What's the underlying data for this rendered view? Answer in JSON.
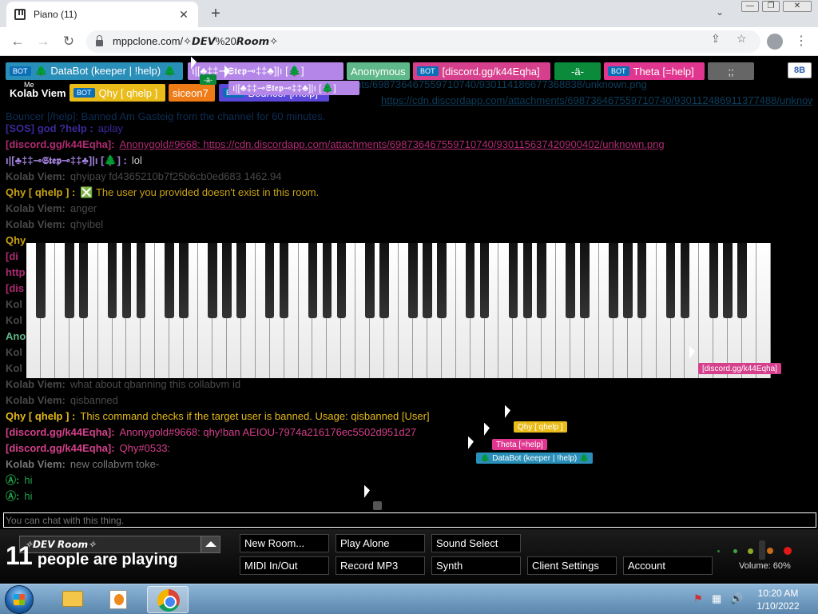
{
  "browser": {
    "tab_title": "Piano (11)",
    "tab_close": "✕",
    "new_tab": "+",
    "tab_search": "⌄",
    "win_min": "—",
    "win_restore": "❐",
    "win_close": "✕",
    "back": "←",
    "forward": "→",
    "reload": "↻",
    "url": "mppclone.com/✧𝘿𝙀𝙑%20𝙍𝙤𝙤𝙢✧",
    "share": "⇪",
    "bookmark": "☆",
    "menu": "⋮"
  },
  "names": [
    {
      "label": "🌲 DataBot (keeper | !help) 🌲",
      "bot": "BOT",
      "color": "#2a8fb8"
    },
    {
      "label": "ı|[♣‡‡⊸𝕾𝖙𝖊𝖕⊸‡‡♣]|ı [🌲]",
      "bot": "",
      "color": "#b486e8"
    },
    {
      "label": "Anonymous",
      "bot": "",
      "color": "#5fb889"
    },
    {
      "label": "[discord.gg/k44Eqha]",
      "bot": "BOT",
      "color": "#d63f8c"
    },
    {
      "label": "-ä-",
      "bot": "",
      "color": "#0a8a3a"
    },
    {
      "label": "Theta [=help]",
      "bot": "BOT",
      "color": "#e0368f"
    },
    {
      "label": ";;",
      "bot": "",
      "color": "#666666"
    },
    {
      "label": "Kolab Viem",
      "bot": "",
      "color": "#000000"
    },
    {
      "label": "Qhy [ qhelp ]",
      "bot": "BOT",
      "color": "#e9bc1a"
    },
    {
      "label": "siceon7",
      "bot": "",
      "color": "#ef7b16"
    },
    {
      "label": "Bouncer [/help]",
      "bot": "BOT",
      "color": "#5b48d8"
    }
  ],
  "badges": {
    "me": "Me",
    "ab": "8B"
  },
  "floating": {
    "a": "-ä-",
    "step": "ı|[♣‡‡⊸𝕾𝖙𝖊𝖕⊸‡‡♣]|ı [🌲]"
  },
  "chat": [
    {
      "name": "[SOS] god ?help :",
      "text": "aplay",
      "ncolor": "#3a2a9a",
      "tcolor": "#3a2a9a"
    },
    {
      "name": "[discord.gg/k44Eqha]:",
      "text": "Anonygold#9668: https://cdn.discordapp.com/attachments/698736467559710740/930115637420900402/unknown.png",
      "ncolor": "#b02a72",
      "tcolor": "#b02a72"
    },
    {
      "name": "ı|[♣‡‡⊸𝕾𝖙𝖊𝖕⊸‡‡♣]|ı [🌲] :",
      "text": "lol",
      "ncolor": "#a17fd9",
      "tcolor": "#cccccc"
    },
    {
      "name": "Kolab Viem:",
      "text": "qhyipay fd4365210b7f25b6cb0ed683 1462.94",
      "ncolor": "#4a4a4a",
      "tcolor": "#4a4a4a"
    },
    {
      "name": "Qhy [ qhelp ] :",
      "text": "❎ The user you provided doesn't exist in this room.",
      "ncolor": "#c9a313",
      "tcolor": "#c9a313"
    },
    {
      "name": "Kolab Viem:",
      "text": "anger",
      "ncolor": "#4a4a4a",
      "tcolor": "#4a4a4a"
    },
    {
      "name": "Kolab Viem:",
      "text": "qhyibel",
      "ncolor": "#4a4a4a",
      "tcolor": "#4a4a4a"
    },
    {
      "name": "Qhy",
      "text": "",
      "ncolor": "#c9a313",
      "tcolor": "#c9a313"
    },
    {
      "name": "[di",
      "text": "",
      "ncolor": "#b02a72",
      "tcolor": "#b02a72"
    },
    {
      "name": "http",
      "text": "",
      "ncolor": "#b02a72",
      "tcolor": "#b02a72"
    },
    {
      "name": "[dis",
      "text": "",
      "ncolor": "#b02a72",
      "tcolor": "#b02a72"
    },
    {
      "name": "Kol",
      "text": "",
      "ncolor": "#4a4a4a",
      "tcolor": "#4a4a4a"
    },
    {
      "name": "Kol",
      "text": "",
      "ncolor": "#4a4a4a",
      "tcolor": "#4a4a4a"
    },
    {
      "name": "Ano",
      "text": "",
      "ncolor": "#5fb889",
      "tcolor": "#5fb889"
    },
    {
      "name": "Kol",
      "text": "",
      "ncolor": "#4a4a4a",
      "tcolor": "#4a4a4a"
    },
    {
      "name": "Kol",
      "text": "",
      "ncolor": "#4a4a4a",
      "tcolor": "#4a4a4a"
    },
    {
      "name": "Kolab Viem:",
      "text": "what about qbanning this collabvm id",
      "ncolor": "#4a4a4a",
      "tcolor": "#4a4a4a"
    },
    {
      "name": "Kolab Viem:",
      "text": "qisbanned",
      "ncolor": "#4a4a4a",
      "tcolor": "#4a4a4a"
    },
    {
      "name": "Qhy [ qhelp ] :",
      "text": "This command checks if the target user is banned. Usage: qisbanned [User]",
      "ncolor": "#e3b91a",
      "tcolor": "#e3b91a"
    },
    {
      "name": "[discord.gg/k44Eqha]:",
      "text": "Anonygold#9668: qhy!ban AEIOU-7974a216176ec5502d951d27",
      "ncolor": "#d63f8c",
      "tcolor": "#d63f8c"
    },
    {
      "name": "[discord.gg/k44Eqha]:",
      "text": "Qhy#0533:",
      "ncolor": "#d63f8c",
      "tcolor": "#d63f8c"
    },
    {
      "name": "Kolab Viem:",
      "text": "new collabvm toke-",
      "ncolor": "#777777",
      "tcolor": "#777777"
    },
    {
      "name": "Ⓐ:",
      "text": "hi",
      "ncolor": "#1fa34a",
      "tcolor": "#1fa34a"
    },
    {
      "name": "Ⓐ:",
      "text": "hi",
      "ncolor": "#1fa34a",
      "tcolor": "#1fa34a"
    }
  ],
  "top_links": {
    "l1": "ments/698736467559710740/930114186677368838/unknown.png",
    "l2": "https://cdn.discordapp.com/attachments/698736467559710740/930112486911377488/unknown.png",
    "bouncer": "Bouncer [/help]:  Banned Am Gasteig from the channel for 60 minutes."
  },
  "cursor_tags": [
    {
      "label": "[discord.gg/k44Eqha]",
      "color": "#d63f8c"
    },
    {
      "label": "Qhy [ qhelp ]",
      "color": "#e9bc1a"
    },
    {
      "label": "Theta [=help]",
      "color": "#e0368f"
    },
    {
      "label": "🌲 DataBot (keeper | !help) 🌲",
      "color": "#2a8fb8"
    }
  ],
  "chat_input": {
    "placeholder": "You can chat with this thing."
  },
  "room": {
    "name": "✧𝘿𝙀𝙑 𝙍𝙤𝙤𝙢✧",
    "count": "11",
    "count_text": "people are playing"
  },
  "buttons": {
    "new_room": "New Room...",
    "play_alone": "Play Alone",
    "sound_select": "Sound Select",
    "midi": "MIDI In/Out",
    "record": "Record MP3",
    "synth": "Synth",
    "client_settings": "Client Settings",
    "account": "Account"
  },
  "volume": {
    "label": "Volume: 60%",
    "value": 0.6
  },
  "taskbar": {
    "time": "10:20 AM",
    "date": "1/10/2022",
    "tray1": "⚑",
    "tray2": "▦",
    "tray3": "🔊"
  },
  "colors": {
    "page_bg": "#000000",
    "accent": "#0b6fb8"
  }
}
